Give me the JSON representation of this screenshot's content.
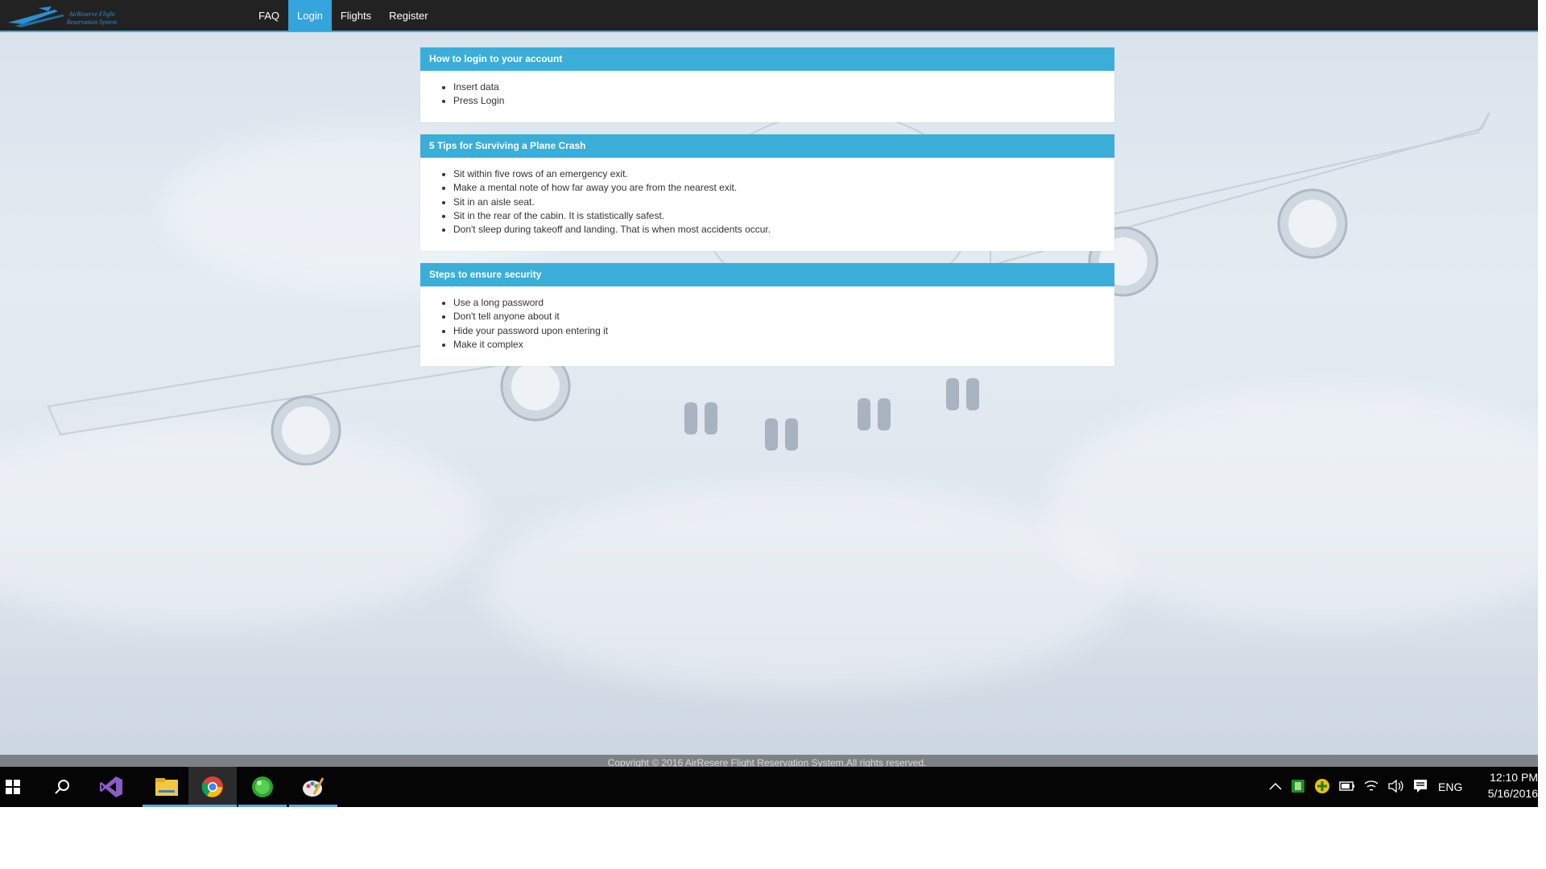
{
  "navbar": {
    "brand": "AirReserve Flight Reservation System",
    "items": [
      {
        "label": "FAQ",
        "active": false
      },
      {
        "label": "Login",
        "active": true
      },
      {
        "label": "Flights",
        "active": false
      },
      {
        "label": "Register",
        "active": false
      }
    ]
  },
  "panels": [
    {
      "heading": "How to login to your account",
      "items": [
        "Insert data",
        "Press Login"
      ]
    },
    {
      "heading": "5 Tips for Surviving a Plane Crash",
      "items": [
        "Sit within five rows of an emergency exit.",
        "Make a mental note of how far away you are from the nearest exit.",
        "Sit in an aisle seat.",
        "Sit in the rear of the cabin. It is statistically safest.",
        "Don't sleep during takeoff and landing. That is when most accidents occur."
      ]
    },
    {
      "heading": "Steps to ensure security",
      "items": [
        "Use a long password",
        "Don't tell anyone about it",
        "Hide your password upon entering it",
        "Make it complex"
      ]
    }
  ],
  "footer": {
    "text": "Copyright © 2016 AirResere Flight Reservation System.All rights reserved."
  },
  "taskbar": {
    "apps": [
      "windows-start",
      "search",
      "visual-studio",
      "file-explorer",
      "chrome",
      "green-orb-app",
      "paint"
    ],
    "language": "ENG",
    "time": "12:10 PM",
    "date": "5/16/2016"
  },
  "colors": {
    "accent": "#3aaed8",
    "navbar": "#222222",
    "taskbar": "#050505"
  }
}
